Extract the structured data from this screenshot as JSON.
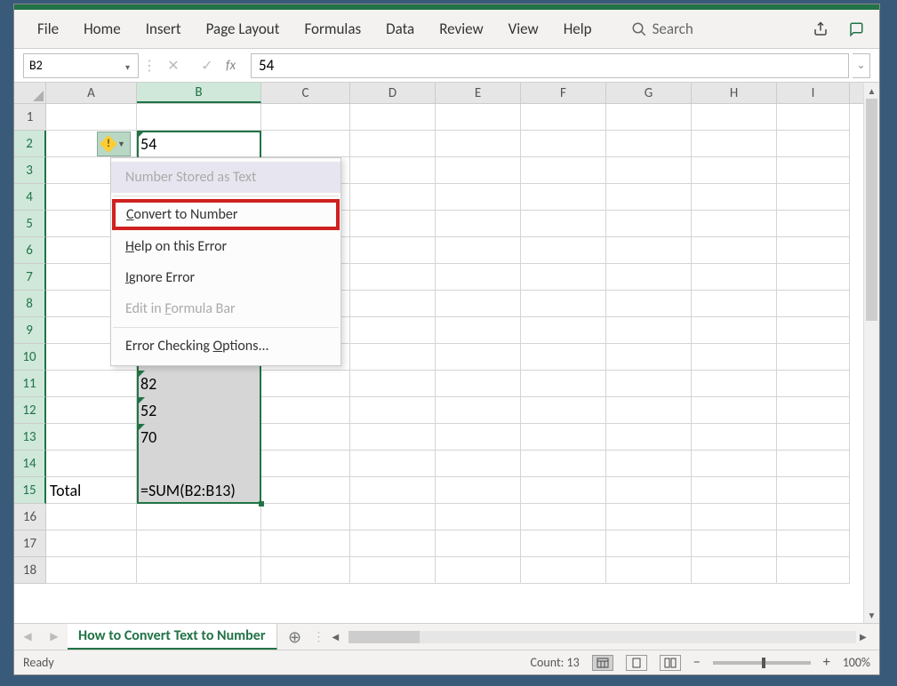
{
  "ribbon": {
    "tabs": [
      "File",
      "Home",
      "Insert",
      "Page Layout",
      "Formulas",
      "Data",
      "Review",
      "View",
      "Help"
    ],
    "search_placeholder": "Search"
  },
  "namebox": {
    "value": "B2"
  },
  "formulabar": {
    "fx": "fx",
    "value": "54"
  },
  "columns": [
    "A",
    "B",
    "C",
    "D",
    "E",
    "F",
    "G",
    "H",
    "I"
  ],
  "selected_col_index": 1,
  "row_count": 18,
  "selected_rows_start": 2,
  "selected_rows_end": 15,
  "cells": {
    "B2": "54",
    "B11": "82",
    "B12": "52",
    "B13": "70",
    "A15": "Total",
    "B15": "=SUM(B2:B13)"
  },
  "green_triangle_cells": [
    "B2",
    "B11",
    "B12",
    "B13"
  ],
  "error_menu": {
    "header": "Number Stored as Text",
    "items": [
      {
        "label": "Convert to Number",
        "underline": "C",
        "highlighted": true
      },
      {
        "label": "Help on this Error",
        "underline": "H"
      },
      {
        "label": "Ignore Error",
        "underline": "I"
      },
      {
        "label": "Edit in Formula Bar",
        "underline": "F",
        "dim": true
      },
      {
        "sep": true
      },
      {
        "label": "Error Checking Options...",
        "underline": "O"
      }
    ]
  },
  "sheet": {
    "name": "How to Convert Text to Number"
  },
  "statusbar": {
    "ready": "Ready",
    "count_label": "Count: 13",
    "zoom": "100%"
  }
}
